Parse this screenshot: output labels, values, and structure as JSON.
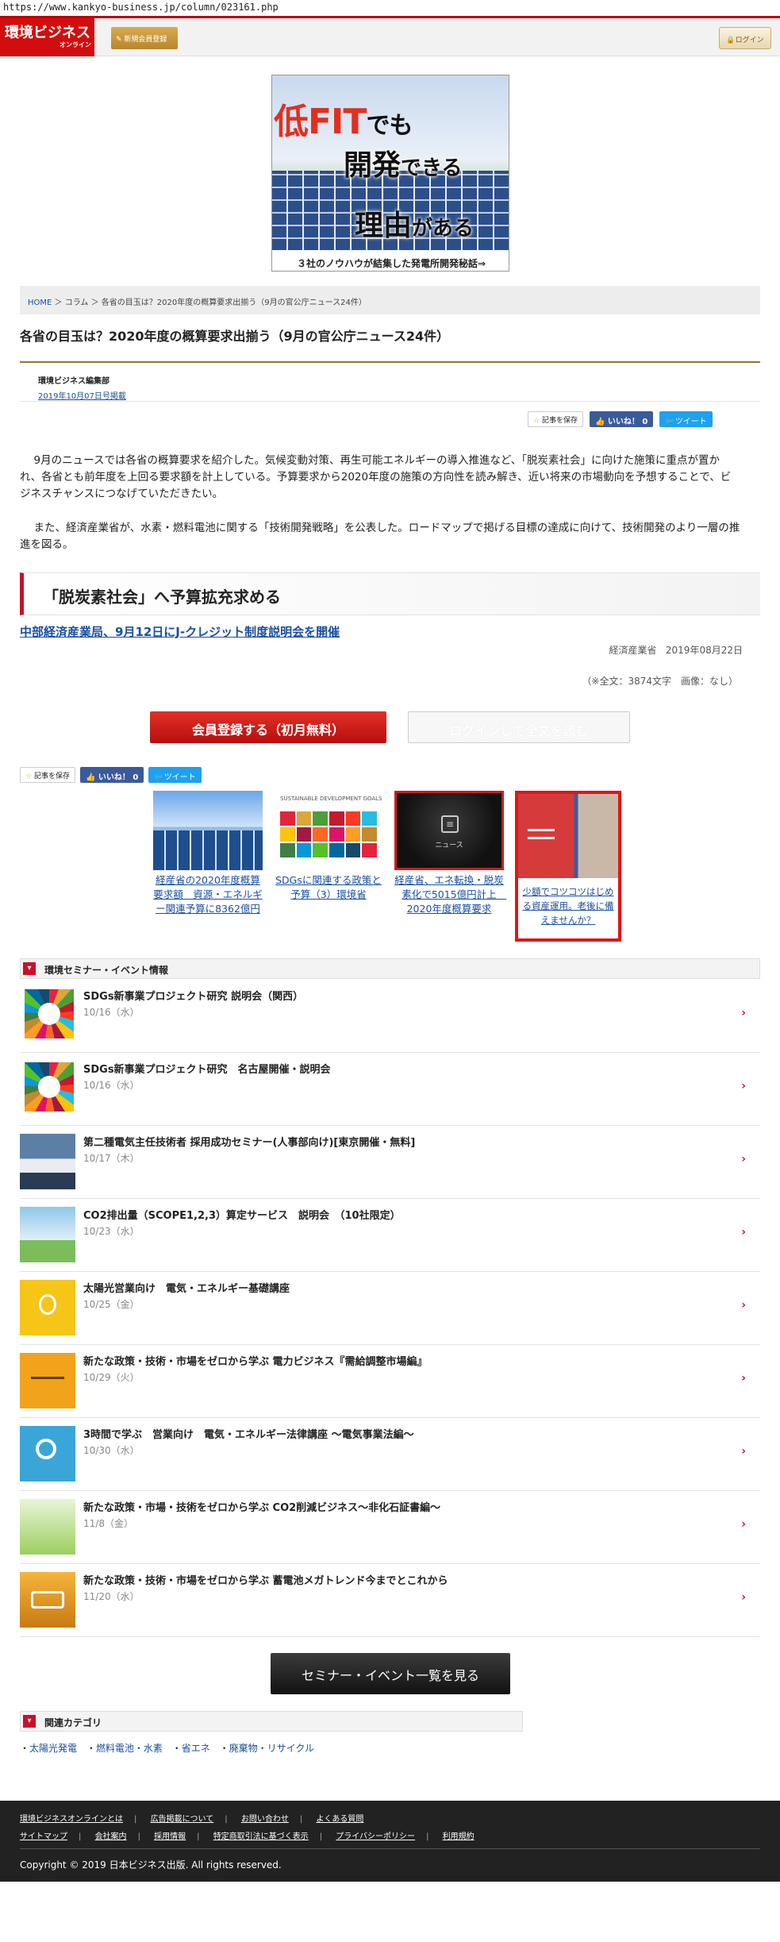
{
  "browser": {
    "url": "https://www.kankyo-business.jp/column/023161.php"
  },
  "header": {
    "logo_main": "環境ビジネス",
    "logo_sub": "オンライン",
    "register_label": "新規会員登録",
    "login_label": "ログイン",
    "colors": {
      "brand": "#d30d0d",
      "accent": "#c8102e"
    }
  },
  "banner": {
    "line1_a": "低FIT",
    "line1_b": "でも",
    "line2_a": "開発",
    "line2_b": "できる",
    "line3_a": "理由",
    "line3_b": "がある",
    "footer": "３社のノウハウが結集した発電所開発秘話⇒"
  },
  "breadcrumb": {
    "home": "HOME",
    "sep": "＞",
    "column": "コラム",
    "current": "各省の目玉は？2020年度の概算要求出揃う（9月の官公庁ニュース24件）"
  },
  "article": {
    "title": "各省の目玉は？2020年度の概算要求出揃う（9月の官公庁ニュース24件）",
    "author": "環境ビジネス編集部",
    "date": "2019年10月07日号掲載",
    "save_label": "記事を保存",
    "like_label": "いいね！ 0",
    "tweet_label": "ツイート",
    "para1": "9月のニュースでは各省の概算要求を紹介した。気候変動対策、再生可能エネルギーの導入推進など、「脱炭素社会」に向けた施策に重点が置かれ、各省とも前年度を上回る要求額を計上している。予算要求から2020年度の施策の方向性を読み解き、近い将来の市場動向を予想することで、ビジネスチャンスにつなげていただきたい。",
    "para2": "また、経済産業省が、水素・燃料電池に関する「技術開発戦略」を公表した。ロードマップで掲げる目標の達成に向けて、技術開発のより一層の推進を図る。",
    "section_title": "「脱炭素社会」へ予算拡充求める",
    "sub_link": "中部経済産業局、9月12日にJ-クレジット制度説明会を開催",
    "sub_source": "経済産業省",
    "sub_date": "2019年08月22日",
    "count_note": "（※全文：3874文字　画像：なし）",
    "register_cta": "会員登録する（初月無料）",
    "login_cta": "ログインして全文を読む"
  },
  "related": [
    {
      "caption": "経産省の2020年度概算要求額　資源・エネルギー関連予算に8362億円",
      "icon": "solar-panel-photo"
    },
    {
      "caption": "SDGsに関連する政策と予算（3）環境省",
      "icon": "sdgs-goals-grid",
      "thumb_text": "SUSTAINABLE DEVELOPMENT GOALS"
    },
    {
      "caption": "経産省、エネ転換・脱炭素化で5015億円計上　2020年度概算要求",
      "icon": "news-icon",
      "thumb_text": "ニュース"
    },
    {
      "caption": "少額でコツコツはじめる資産運用。老後に備えませんか？",
      "icon": "ad-image"
    }
  ],
  "seminars": {
    "heading": "環境セミナー・イベント情報",
    "items": [
      {
        "title": "SDGs新事業プロジェクト研究 説明会（関西）",
        "date": "10/16（水）",
        "icon": "sdgs-wheel"
      },
      {
        "title": "SDGs新事業プロジェクト研究　名古屋開催・説明会",
        "date": "10/16（水）",
        "icon": "sdgs-wheel"
      },
      {
        "title": "第二種電気主任技術者 採用成功セミナー(人事部向け)[東京開催・無料]",
        "date": "10/17（木）",
        "icon": "seminar-room"
      },
      {
        "title": "CO2排出量（SCOPE1,2,3）算定サービス　説明会　（10社限定）",
        "date": "10/23（水）",
        "icon": "city-buildings"
      },
      {
        "title": "太陽光営業向け　電気・エネルギー基礎講座",
        "date": "10/25（金）",
        "icon": "lightbulb"
      },
      {
        "title": "新たな政策・技術・市場をゼロから学ぶ 電力ビジネス『需給調整市場編』",
        "date": "10/29（火）",
        "icon": "balance-scale"
      },
      {
        "title": "3時間で学ぶ　営業向け　電気・エネルギー法律講座 ～電気事業法編～",
        "date": "10/30（水）",
        "icon": "magnifier-chart"
      },
      {
        "title": "新たな政策・市場・技術をゼロから学ぶ CO2削減ビジネス～非化石証書編～",
        "date": "11/8（金）",
        "icon": "green-bulb"
      },
      {
        "title": "新たな政策・技術・市場をゼロから学ぶ 蓄電池メガトレンド今までとこれから",
        "date": "11/20（水）",
        "icon": "battery"
      }
    ],
    "see_all": "セミナー・イベント一覧を見る"
  },
  "categories": {
    "heading": "関連カテゴリ",
    "items": [
      "太陽光発電",
      "燃料電池・水素",
      "省エネ",
      "廃棄物・リサイクル"
    ]
  },
  "footer": {
    "row1": [
      "環境ビジネスオンラインとは",
      "広告掲載について",
      "お問い合わせ",
      "よくある質問"
    ],
    "row2": [
      "サイトマップ",
      "会社案内",
      "採用情報",
      "特定商取引法に基づく表示",
      "プライバシーポリシー",
      "利用規約"
    ],
    "copyright": "Copyright © 2019 日本ビジネス出版. All rights reserved."
  }
}
